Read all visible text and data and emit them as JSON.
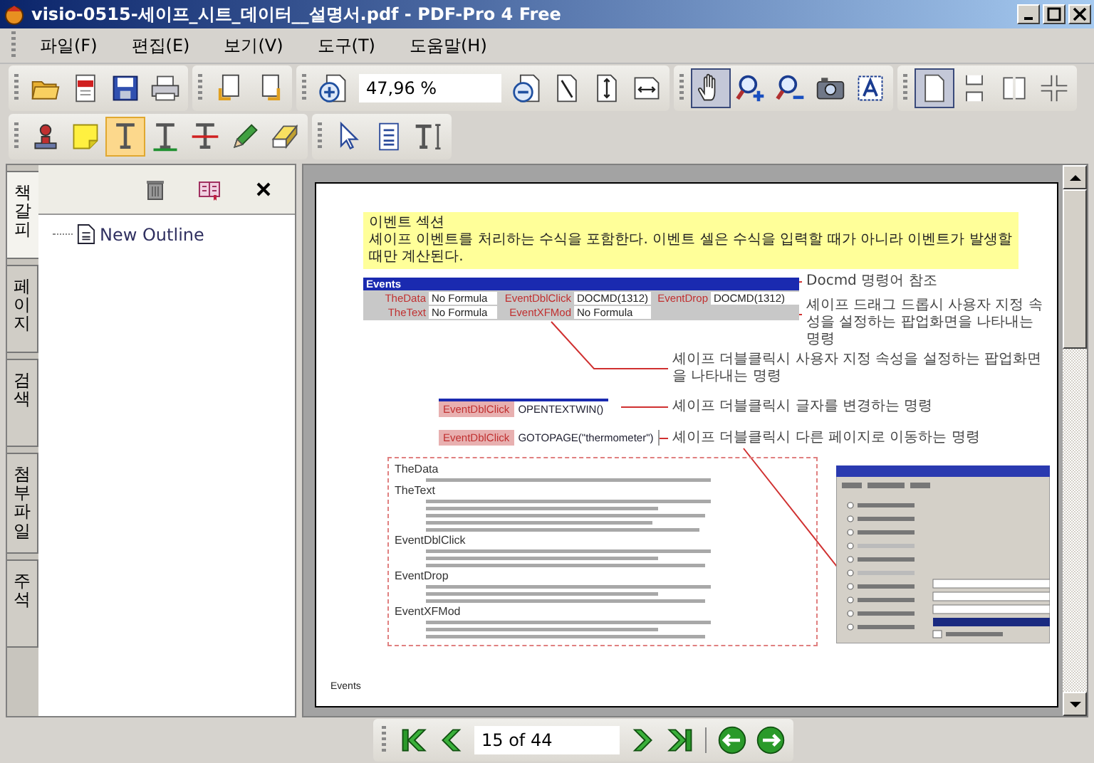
{
  "window": {
    "title": "visio-0515-세이프_시트_데이터__설명서.pdf - PDF-Pro 4 Free"
  },
  "menu": [
    "파일(F)",
    "편집(E)",
    "보기(V)",
    "도구(T)",
    "도움말(H)"
  ],
  "toolbar_1": {
    "zoom_value": "47,96 %",
    "groups": [
      [
        {
          "selected": false
        },
        {
          "selected": false
        },
        {
          "selected": false
        },
        {
          "selected": false
        }
      ],
      [
        {
          "selected": false
        },
        {
          "selected": false
        }
      ],
      [
        {
          "selected": false
        },
        {
          "selected": false
        },
        {
          "selected": false
        },
        {
          "selected": false
        },
        {
          "selected": false
        }
      ],
      [
        {
          "selected": true
        },
        {
          "selected": false
        },
        {
          "selected": false
        },
        {
          "selected": false
        },
        {
          "selected": false
        }
      ],
      [
        {
          "selected": true
        },
        {
          "selected": false
        },
        {
          "selected": false
        },
        {
          "selected": false
        }
      ]
    ]
  },
  "toolbar_2": {
    "groups": [
      [
        {
          "selected": false
        },
        {
          "selected": false
        },
        {
          "selected": true
        },
        {
          "selected": false
        },
        {
          "selected": false
        },
        {
          "selected": false
        },
        {
          "selected": false
        }
      ],
      [
        {
          "selected": false
        },
        {
          "selected": false
        },
        {
          "selected": false
        }
      ]
    ]
  },
  "side_tabs": [
    {
      "label": "책갈피",
      "selected": true
    },
    {
      "label": "페이지",
      "selected": false
    },
    {
      "label": "검색",
      "selected": false
    },
    {
      "label": "첨부파일",
      "selected": false
    },
    {
      "label": "주석",
      "selected": false
    }
  ],
  "outline": [
    {
      "label": "New Outline"
    }
  ],
  "document_page": {
    "section_box": {
      "title": "이벤트 섹션",
      "text": "셰이프 이벤트를 처리하는 수식을 포함한다. 이벤트 셀은 수식을 입력할 때가 아니라 이벤트가 발생할 때만 계산된다."
    },
    "events_table": {
      "title": "Events",
      "cells": [
        {
          "name": "TheData",
          "value": "No Formula"
        },
        {
          "name": "EventDblClick",
          "value": "DOCMD(1312)"
        },
        {
          "name": "EventDrop",
          "value": "DOCMD(1312)"
        },
        {
          "name": "TheText",
          "value": "No Formula"
        },
        {
          "name": "EventXFMod",
          "value": "No Formula"
        }
      ]
    },
    "annotations": [
      "Docmd 명령어 참조",
      "셰이프 드래그 드롭시 사용자 지정 속성을 설정하는 팝업화면을 나타내는 명령",
      "셰이프 더블클릭시 사용자 지정 속성을 설정하는 팝업화면을 나타내는 명령"
    ],
    "formula_rows": [
      {
        "name": "EventDblClick",
        "value": "OPENTEXTWIN()",
        "note": "셰이프 더블클릭시 글자를 변경하는 명령"
      },
      {
        "name": "EventDblClick",
        "value": "GOTOPAGE(\"thermometer\")",
        "note": "셰이프 더블클릭시 다른 페이지로 이동하는 명령"
      }
    ],
    "definitions": [
      {
        "term": "TheData"
      },
      {
        "term": "TheText"
      },
      {
        "term": "EventDblClick"
      },
      {
        "term": "EventDrop"
      },
      {
        "term": "EventXFMod"
      }
    ],
    "footer": "Events"
  },
  "page_nav": {
    "value": "15 of 44"
  }
}
